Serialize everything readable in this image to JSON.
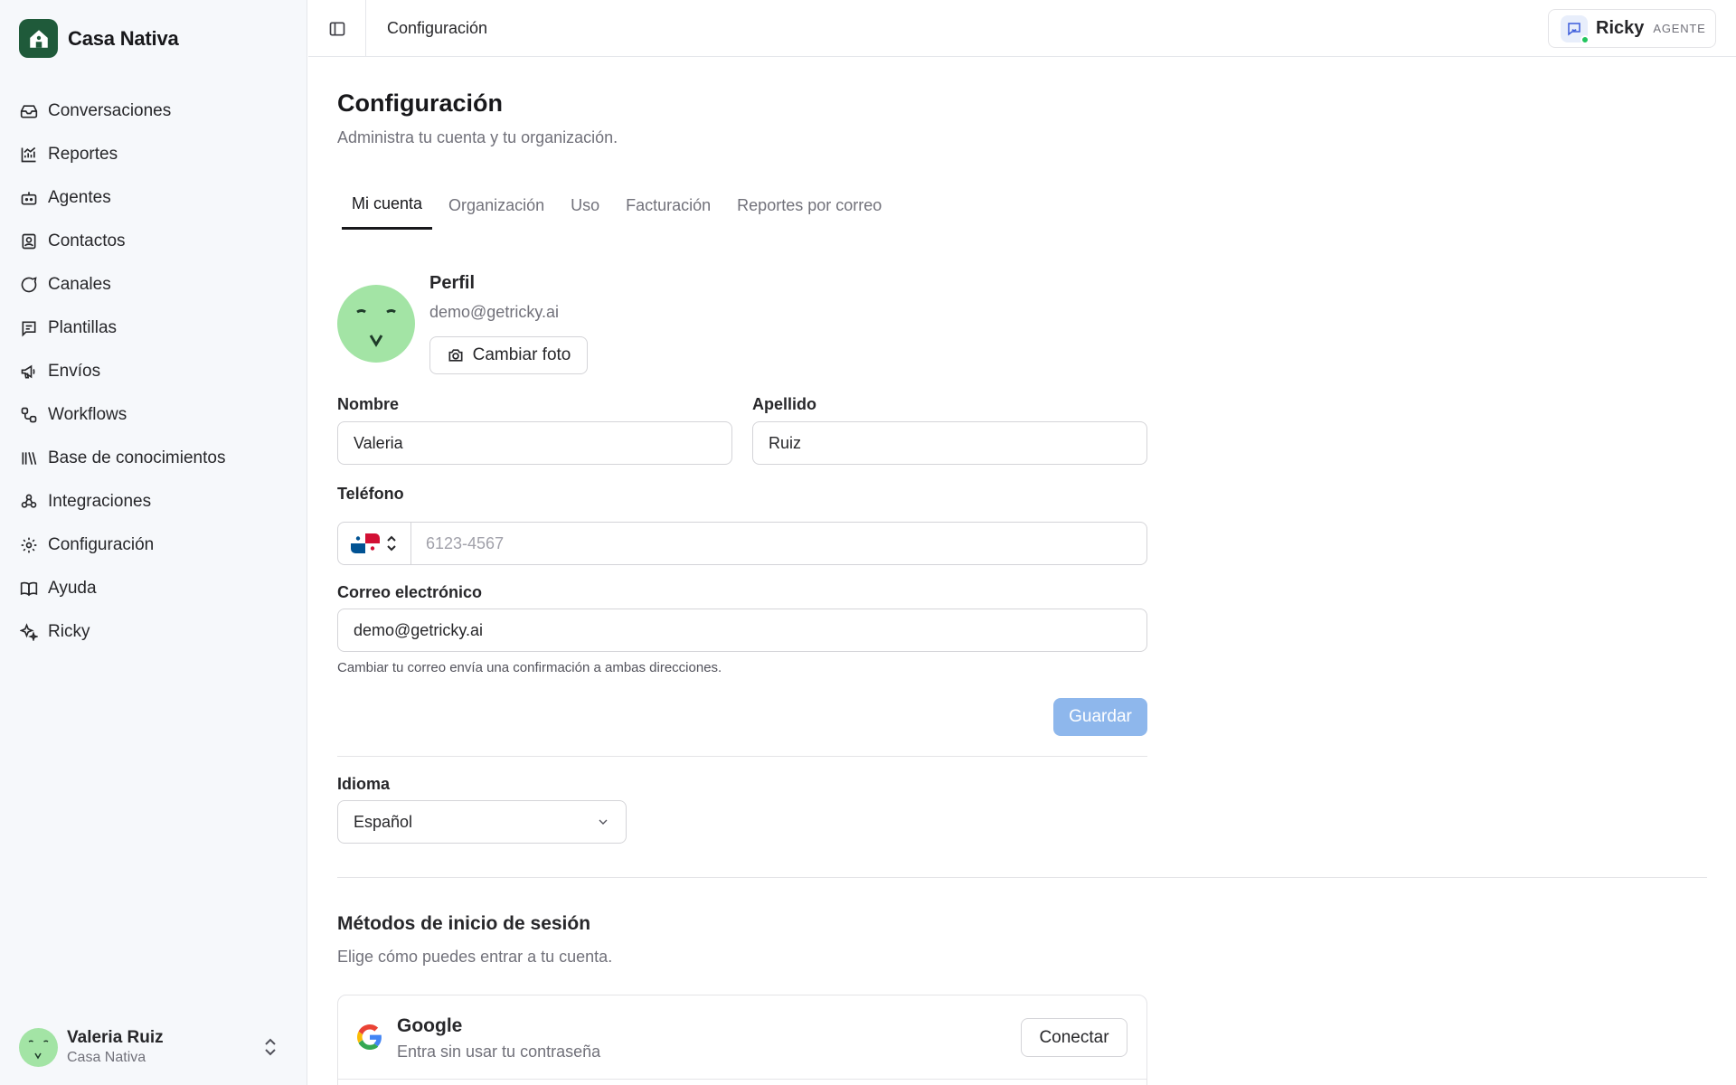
{
  "brand": {
    "name": "Casa Nativa"
  },
  "sidebar": {
    "items": [
      {
        "label": "Conversaciones",
        "icon": "inbox-icon"
      },
      {
        "label": "Reportes",
        "icon": "chart-icon"
      },
      {
        "label": "Agentes",
        "icon": "bot-icon"
      },
      {
        "label": "Contactos",
        "icon": "contact-book-icon"
      },
      {
        "label": "Canales",
        "icon": "chat-bubble-icon"
      },
      {
        "label": "Plantillas",
        "icon": "template-icon"
      },
      {
        "label": "Envíos",
        "icon": "megaphone-icon"
      },
      {
        "label": "Workflows",
        "icon": "workflow-icon"
      },
      {
        "label": "Base de conocimientos",
        "icon": "library-icon"
      },
      {
        "label": "Integraciones",
        "icon": "integrations-icon"
      },
      {
        "label": "Configuración",
        "icon": "gear-icon"
      },
      {
        "label": "Ayuda",
        "icon": "book-icon"
      },
      {
        "label": "Ricky",
        "icon": "sparkles-icon"
      }
    ],
    "user": {
      "name": "Valeria Ruiz",
      "org": "Casa Nativa"
    }
  },
  "topbar": {
    "title": "Configuración",
    "assistant": {
      "name": "Ricky",
      "role": "AGENTE",
      "status_color": "#22c55e"
    }
  },
  "page": {
    "title": "Configuración",
    "subtitle": "Administra tu cuenta y tu organización.",
    "tabs": [
      {
        "label": "Mi cuenta",
        "active": true
      },
      {
        "label": "Organización",
        "active": false
      },
      {
        "label": "Uso",
        "active": false
      },
      {
        "label": "Facturación",
        "active": false
      },
      {
        "label": "Reportes por correo",
        "active": false
      }
    ]
  },
  "profile": {
    "title": "Perfil",
    "email": "demo@getricky.ai",
    "change_photo_label": "Cambiar foto",
    "avatar_color": "#a3e4a5"
  },
  "form": {
    "first_name_label": "Nombre",
    "first_name_value": "Valeria",
    "last_name_label": "Apellido",
    "last_name_value": "Ruiz",
    "phone_label": "Teléfono",
    "phone_country": "Panamá",
    "phone_placeholder": "6123-4567",
    "email_label": "Correo electrónico",
    "email_value": "demo@getricky.ai",
    "email_hint": "Cambiar tu correo envía una confirmación a ambas direcciones.",
    "save_label": "Guardar"
  },
  "language": {
    "label": "Idioma",
    "value": "Español"
  },
  "login_methods": {
    "title": "Métodos de inicio de sesión",
    "subtitle": "Elige cómo puedes entrar a tu cuenta.",
    "google": {
      "title": "Google",
      "subtitle": "Entra sin usar tu contraseña",
      "button": "Conectar"
    }
  },
  "colors": {
    "brand": "#1f5a3a",
    "primary_disabled": "#8eb7ec",
    "sidebar_bg": "#f6f8fb"
  }
}
